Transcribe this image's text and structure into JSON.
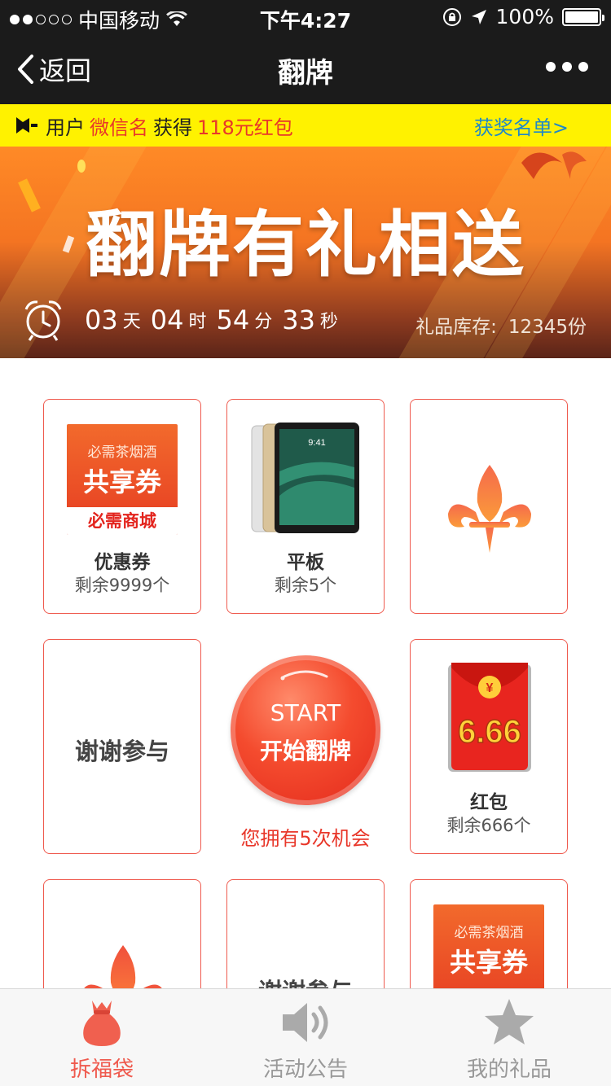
{
  "status_bar": {
    "carrier": "中国移动",
    "time": "下午4:27",
    "battery": "100%"
  },
  "nav": {
    "back_label": "返回",
    "title": "翻牌"
  },
  "notice": {
    "prefix": "用户",
    "username": "微信名",
    "middle": "获得",
    "prize": "118元红包",
    "winners_link": "获奖名单>"
  },
  "banner": {
    "title": "翻牌有礼相送",
    "countdown": {
      "days": "03",
      "days_unit": "天",
      "hours": "04",
      "hours_unit": "时",
      "minutes": "54",
      "minutes_unit": "分",
      "seconds": "33",
      "seconds_unit": "秒"
    },
    "stock_label": "礼品库存:",
    "stock_value": "12345份"
  },
  "cards": {
    "coupon": {
      "image_line1": "必需茶烟酒",
      "image_line2": "共享券",
      "image_line3": "必需商城",
      "name": "优惠券",
      "remain": "剩余9999个"
    },
    "tablet": {
      "screen_time": "9:41",
      "name": "平板",
      "remain": "剩余5个"
    },
    "thanks_1": {
      "label": "谢谢参与"
    },
    "start": {
      "line1": "START",
      "line2": "开始翻牌",
      "chances": "您拥有5次机会"
    },
    "red_packet": {
      "currency": "¥",
      "amount": "6.66",
      "name": "红包",
      "remain": "剩余666个"
    },
    "thanks_2": {
      "label": "谢谢参与"
    },
    "coupon_2": {
      "image_line1": "必需茶烟酒",
      "image_line2": "共享券"
    }
  },
  "tabs": [
    {
      "label": "拆福袋",
      "icon": "lucky-bag-icon",
      "active": true
    },
    {
      "label": "活动公告",
      "icon": "speaker-icon",
      "active": false
    },
    {
      "label": "我的礼品",
      "icon": "star-icon",
      "active": false
    }
  ],
  "colors": {
    "accent": "#ef5a4e",
    "notice_bg": "#fff200",
    "link": "#1e88c9",
    "nav_bg": "#1b1b1b"
  }
}
